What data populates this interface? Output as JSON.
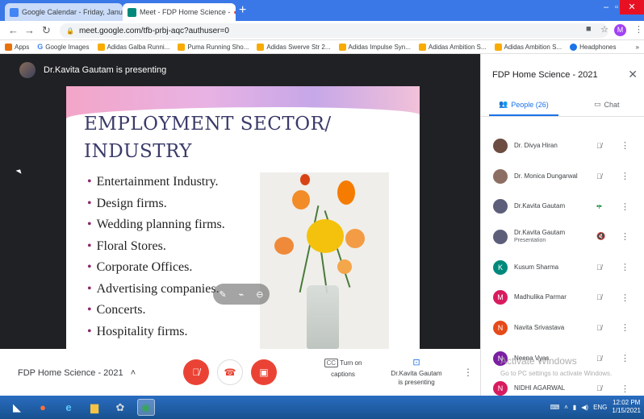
{
  "browser": {
    "tabs": [
      {
        "label": "Google Calendar - Friday, Januar",
        "active": false,
        "favicon_color": "#4285f4"
      },
      {
        "label": "Meet - FDP Home Science -",
        "active": true,
        "favicon_color": "#00897b"
      }
    ],
    "new_tab": "+",
    "url": "meet.google.com/tfb-prbj-aqc?authuser=0",
    "profile_initial": "M",
    "bookmarks": [
      {
        "label": "Apps",
        "icon_color": "#e8710a"
      },
      {
        "label": "Google Images",
        "icon_color": "#4285f4",
        "glyph": "G"
      },
      {
        "label": "Adidas Galba Runni...",
        "icon_color": "#f9ab00"
      },
      {
        "label": "Puma Running Sho...",
        "icon_color": "#f9ab00"
      },
      {
        "label": "Adidas Swerve Str 2...",
        "icon_color": "#f9ab00"
      },
      {
        "label": "Adidas Impulse Syn...",
        "icon_color": "#f9ab00"
      },
      {
        "label": "Adidas Ambition S...",
        "icon_color": "#f9ab00"
      },
      {
        "label": "Adidas Ambition S...",
        "icon_color": "#f9ab00"
      },
      {
        "label": "Headphones",
        "icon_color": "#1a73e8"
      }
    ],
    "bookmarks_overflow": "»"
  },
  "meet": {
    "presenting_label": "Dr.Kavita Gautam is presenting",
    "slide": {
      "title_line1": "EMPLOYMENT SECTOR/",
      "title_line2": "INDUSTRY",
      "bullets": [
        "Entertainment Industry.",
        "Design  firms.",
        "Wedding planning firms.",
        "Floral Stores.",
        "Corporate Offices.",
        "Advertising companies.",
        "Concerts.",
        "Hospitality firms."
      ]
    },
    "controls": {
      "meeting_title": "FDP Home Science - 2021",
      "captions_label": "Turn on captions",
      "captions_icon": "CC",
      "presenting_line1": "Dr.Kavita Gautam",
      "presenting_line2": "is presenting"
    }
  },
  "panel": {
    "title": "FDP Home Science - 2021",
    "people_tab": "People (26)",
    "chat_tab": "Chat",
    "participants": [
      {
        "name": "Dr. Divya Hiran",
        "sub": "",
        "avatar_color": "#6d4c41",
        "initial": "",
        "speaking": false
      },
      {
        "name": "Dr. Monica Dungarwal",
        "sub": "",
        "avatar_color": "#8d6e63",
        "initial": "",
        "speaking": false
      },
      {
        "name": "Dr.Kavita Gautam",
        "sub": "",
        "avatar_color": "#5d5f7a",
        "initial": "",
        "speaking": true
      },
      {
        "name": "Dr.Kavita Gautam",
        "sub": "Presentation",
        "avatar_color": "#5d5f7a",
        "initial": "",
        "speaking": false
      },
      {
        "name": "Kusum Sharma",
        "sub": "",
        "avatar_color": "#00897b",
        "initial": "K",
        "speaking": false
      },
      {
        "name": "Madhulika Parmar",
        "sub": "",
        "avatar_color": "#d81b60",
        "initial": "M",
        "speaking": false
      },
      {
        "name": "Navita Srivastava",
        "sub": "",
        "avatar_color": "#e64a19",
        "initial": "N",
        "speaking": false
      },
      {
        "name": "Neena Vyas",
        "sub": "",
        "avatar_color": "#7b1fa2",
        "initial": "N",
        "speaking": false
      },
      {
        "name": "NIDHI AGARWAL",
        "sub": "",
        "avatar_color": "#d81b60",
        "initial": "N",
        "speaking": false
      }
    ]
  },
  "watermark": {
    "line1": "Activate Windows",
    "line2": "Go to PC settings to activate Windows."
  },
  "taskbar": {
    "tray_lang": "ENG",
    "time": "12:02 PM",
    "date": "1/15/2021"
  }
}
